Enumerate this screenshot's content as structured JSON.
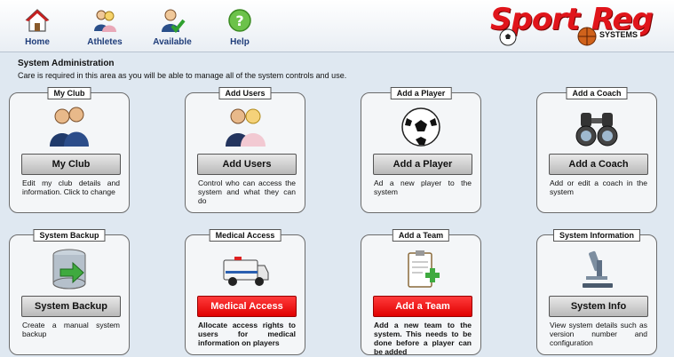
{
  "nav": {
    "items": [
      {
        "label": "Home",
        "icon": "home-icon"
      },
      {
        "label": "Athletes",
        "icon": "athletes-icon"
      },
      {
        "label": "Available",
        "icon": "available-icon"
      },
      {
        "label": "Help",
        "icon": "help-icon"
      }
    ]
  },
  "logo": {
    "sport": "Sport",
    "reg": "Reg",
    "systems": "SYSTEMS"
  },
  "admin": {
    "heading": "System Administration",
    "subtext": "Care is required in this area as you will be able to manage all of the system controls and use."
  },
  "cards": [
    {
      "title": "My Club",
      "button": "My Club",
      "desc": "Edit my club details and information. Click to change",
      "icon": "club-people-icon"
    },
    {
      "title": "Add Users",
      "button": "Add Users",
      "desc": "Control who can access the system and what they can do",
      "icon": "users-icon"
    },
    {
      "title": "Add a Player",
      "button": "Add a Player",
      "desc": "Ad a new player to the system",
      "icon": "soccer-ball-icon"
    },
    {
      "title": "Add a Coach",
      "button": "Add a Coach",
      "desc": "Add or edit a coach in the system",
      "icon": "binoculars-icon"
    },
    {
      "title": "System Backup",
      "button": "System Backup",
      "desc": "Create a manual system backup",
      "icon": "database-backup-icon"
    },
    {
      "title": "Medical Access",
      "button": "Medical Access",
      "desc": "Allocate access rights to users for medical information on players",
      "icon": "ambulance-icon"
    },
    {
      "title": "Add a Team",
      "button": "Add a Team",
      "desc": "Add a new team to the system. This needs to be done before a player can be added",
      "icon": "clipboard-add-icon"
    },
    {
      "title": "System Information",
      "button": "System Info",
      "desc": "View system details such as version number and configuration",
      "icon": "microscope-icon"
    }
  ],
  "colors": {
    "accent_red": "#e00000",
    "nav_blue": "#1f3d7a",
    "background": "#dfe8f1"
  }
}
